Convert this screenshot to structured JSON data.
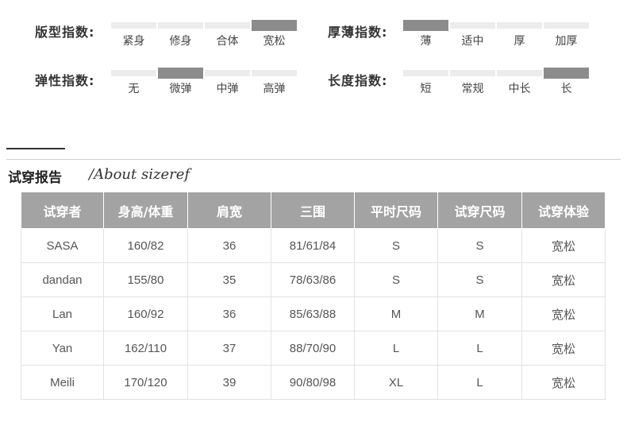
{
  "indices": [
    {
      "label": "版型指数:",
      "options": [
        "紧身",
        "修身",
        "合体",
        "宽松"
      ],
      "selected": 3
    },
    {
      "label": "厚薄指数:",
      "options": [
        "薄",
        "适中",
        "厚",
        "加厚"
      ],
      "selected": 0
    },
    {
      "label": "弹性指数:",
      "options": [
        "无",
        "微弹",
        "中弹",
        "高弹"
      ],
      "selected": 1
    },
    {
      "label": "长度指数:",
      "options": [
        "短",
        "常规",
        "中长",
        "长"
      ],
      "selected": 3
    }
  ],
  "report": {
    "title": "试穿报告",
    "subtitle": "/About sizeref"
  },
  "table": {
    "headers": [
      "试穿者",
      "身高/体重",
      "肩宽",
      "三围",
      "平时尺码",
      "试穿尺码",
      "试穿体验"
    ],
    "rows": [
      [
        "SASA",
        "160/82",
        "36",
        "81/61/84",
        "S",
        "S",
        "宽松"
      ],
      [
        "dandan",
        "155/80",
        "35",
        "78/63/86",
        "S",
        "S",
        "宽松"
      ],
      [
        "Lan",
        "160/92",
        "36",
        "85/63/88",
        "M",
        "M",
        "宽松"
      ],
      [
        "Yan",
        "162/110",
        "37",
        "88/70/90",
        "L",
        "L",
        "宽松"
      ],
      [
        "Meili",
        "170/120",
        "39",
        "90/80/98",
        "XL",
        "L",
        "宽松"
      ]
    ]
  },
  "colors": {
    "header_bg": "#a3a3a3",
    "selected_bar": "#8c8c8c",
    "bar": "#ececec"
  }
}
